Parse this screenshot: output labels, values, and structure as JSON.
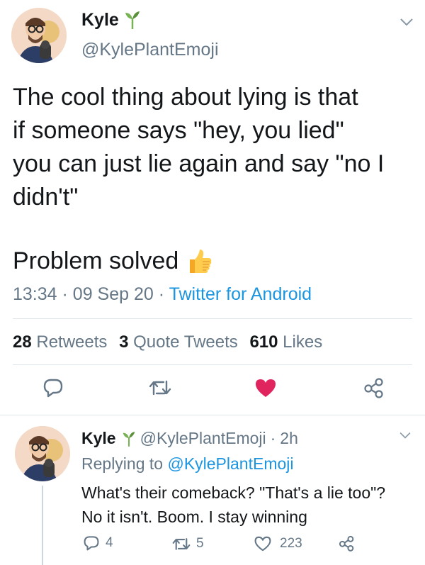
{
  "main_tweet": {
    "author_name": "Kyle",
    "author_handle": "@KylePlantEmoji",
    "text_lines": [
      "The cool thing about lying is that",
      "if someone says \"hey, you lied\"",
      "you can just lie again and say \"no I",
      "didn't\""
    ],
    "text_final": "Problem solved",
    "time": "13:34",
    "sep1": "·",
    "date": "09 Sep 20",
    "sep2": "·",
    "source": "Twitter for Android",
    "stats": {
      "retweets_count": "28",
      "retweets_label": "Retweets",
      "quote_count": "3",
      "quote_label": "Quote Tweets",
      "likes_count": "610",
      "likes_label": "Likes"
    }
  },
  "reply_tweet": {
    "author_name": "Kyle",
    "author_handle": "@KylePlantEmoji",
    "sep": "·",
    "age": "2h",
    "replying_prefix": "Replying to",
    "replying_handle": "@KylePlantEmoji",
    "text_lines": [
      "What's their comeback? \"That's a lie too\"?",
      "No it isn't. Boom. I stay winning"
    ],
    "actions": {
      "reply_count": "4",
      "retweet_count": "5",
      "like_count": "223"
    }
  },
  "colors": {
    "text": "#14171a",
    "muted": "#657786",
    "link": "#1b95e0",
    "like_red": "#e0245e",
    "divider": "#e1e8ed",
    "plant_green": "#77b255"
  },
  "icons": [
    "plant-emoji-icon",
    "chevron-down-icon",
    "thumbs-up-emoji-icon",
    "reply-icon",
    "retweet-icon",
    "heart-icon",
    "share-icon"
  ]
}
